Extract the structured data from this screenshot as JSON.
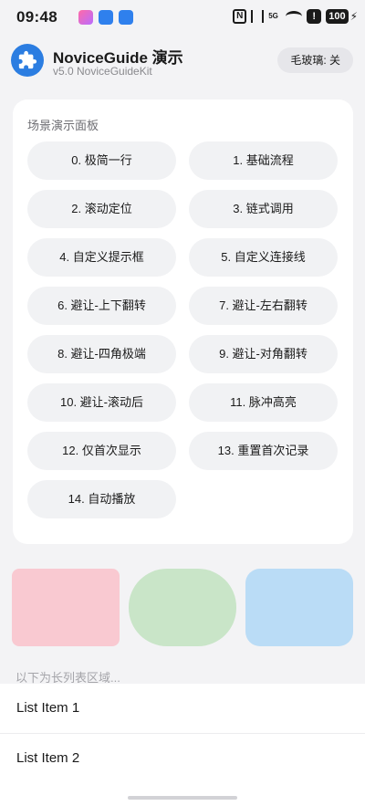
{
  "status_bar": {
    "time": "09:48",
    "signal_label": "5G",
    "alert": "!",
    "battery": "100"
  },
  "header": {
    "icon": "puzzle-icon",
    "title": "NoviceGuide 演示",
    "subtitle": "v5.0 NoviceGuideKit",
    "frost_button": "毛玻璃: 关"
  },
  "panel": {
    "title": "场景演示面板",
    "buttons": [
      "0. 极简一行",
      "1. 基础流程",
      "2. 滚动定位",
      "3. 链式调用",
      "4. 自定义提示框",
      "5. 自定义连接线",
      "6. 避让-上下翻转",
      "7. 避让-左右翻转",
      "8. 避让-四角极端",
      "9. 避让-对角翻转",
      "10. 避让-滚动后",
      "11. 脉冲高亮",
      "12. 仅首次显示",
      "13. 重置首次记录",
      "14. 自动播放"
    ]
  },
  "shapes": {
    "colors": [
      "#f9c9d1",
      "#c9e5c8",
      "#badcf6"
    ]
  },
  "list": {
    "hint": "以下为长列表区域...",
    "items": [
      "List Item 1",
      "List Item 2"
    ]
  }
}
